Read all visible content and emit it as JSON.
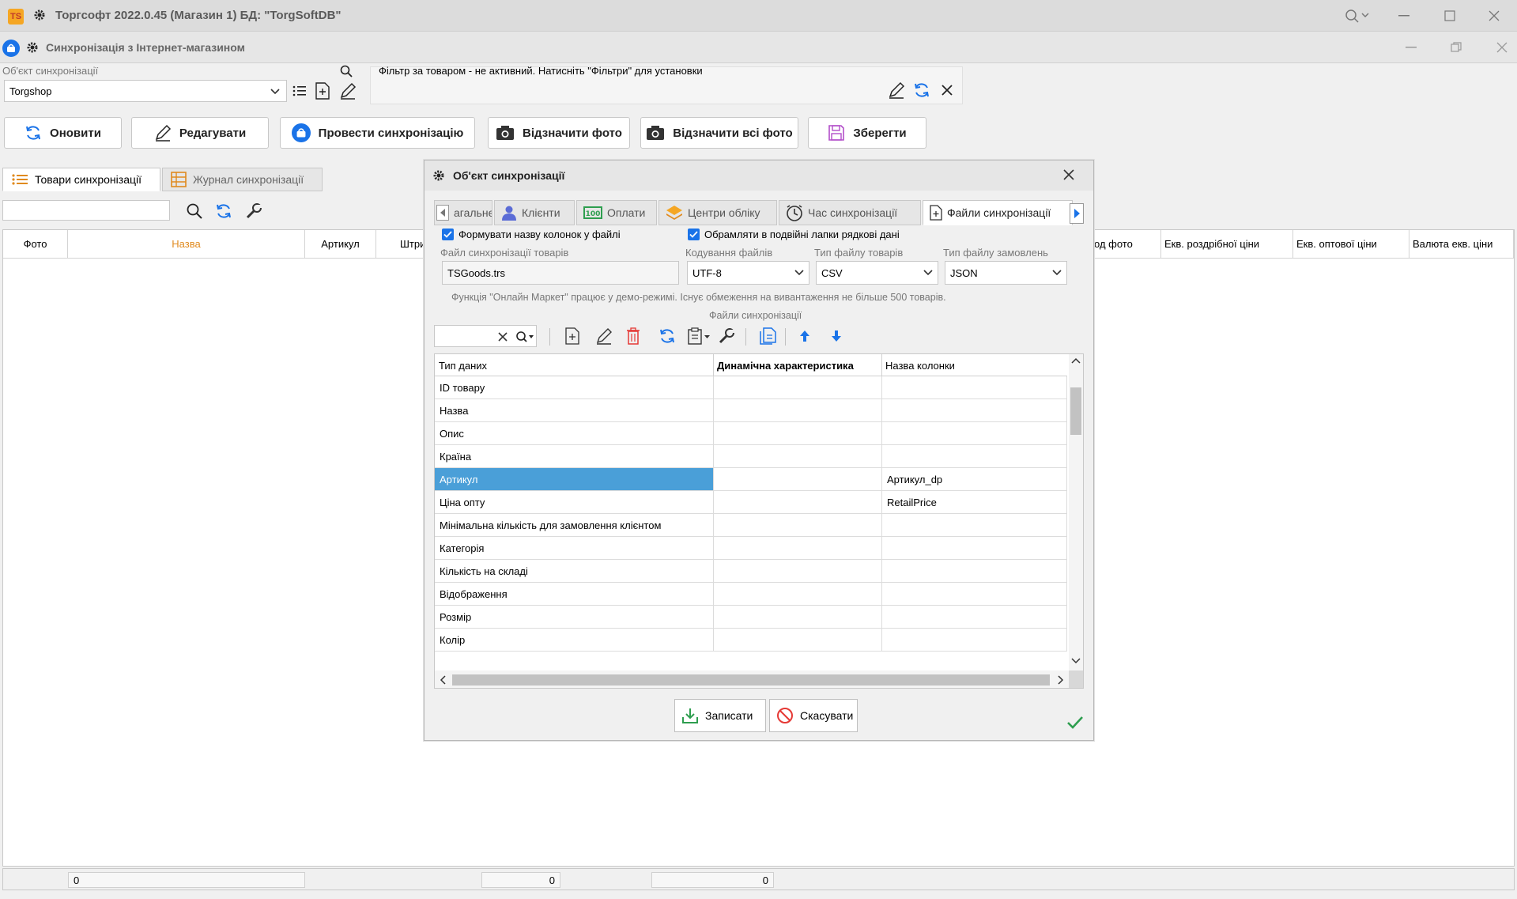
{
  "app": {
    "title": "Торгсофт 2022.0.45 (Магазин 1) БД: \"TorgSoftDB\"",
    "logo_text": "TS"
  },
  "window": {
    "title": "Синхронізація з Інтернет-магазином"
  },
  "object": {
    "label": "Об'єкт синхронізації",
    "value": "Torgshop"
  },
  "filter": {
    "text": "Фільтр за товаром - не активний. Натисніть \"Фільтри\" для установки"
  },
  "toolbar": {
    "refresh": "Оновити",
    "edit": "Редагувати",
    "sync": "Провести синхронізацію",
    "mark_photo": "Відзначити фото",
    "mark_all_photo": "Відзначити всі фото",
    "save": "Зберегти"
  },
  "tabs": [
    {
      "label": "Товари синхронізації"
    },
    {
      "label": "Журнал синхронізації"
    }
  ],
  "grid": {
    "columns": [
      "Фото",
      "Назва",
      "Артикул",
      "Штри",
      "од фото",
      "Екв. роздрібної ціни",
      "Екв. оптової ціни",
      "Валюта екв. ціни"
    ]
  },
  "status": {
    "f1": "0",
    "f2": "0",
    "f3": "0"
  },
  "dialog": {
    "title": "Об'єкт синхронізації",
    "tabs": [
      "агальне",
      "Клієнти",
      "Оплати",
      "Центри обліку",
      "Час синхронізації",
      "Файли синхронізації"
    ],
    "check1": "Формувати назву колонок у файлі",
    "check2": "Обрамляти в подвійні лапки рядкові дані",
    "file_label": "Файл синхронізації товарів",
    "file_value": "TSGoods.trs",
    "enc_label": "Кодування файлів",
    "enc_value": "UTF-8",
    "goods_type_label": "Тип файлу товарів",
    "goods_type_value": "CSV",
    "orders_type_label": "Тип файлу замовлень",
    "orders_type_value": "JSON",
    "demo_note": "Функція \"Онлайн Маркет\" працює у демо-режимі. Існує обмеження на вивантаження не більше 500 товарів.",
    "files_section": "Файли синхронізації",
    "table": {
      "headers": [
        "Тип даних",
        "Динамічна характеристика",
        "Назва колонки"
      ],
      "rows": [
        [
          "ID товару",
          "",
          ""
        ],
        [
          "Назва",
          "",
          ""
        ],
        [
          "Опис",
          "",
          ""
        ],
        [
          "Країна",
          "",
          ""
        ],
        [
          "Артикул",
          "",
          "Артикул_dp"
        ],
        [
          "Ціна опту",
          "",
          "RetailPrice"
        ],
        [
          "Мінімальна кількість для замовлення клієнтом",
          "",
          ""
        ],
        [
          "Категорія",
          "",
          ""
        ],
        [
          "Кількість на складі",
          "",
          ""
        ],
        [
          "Відображення",
          "",
          ""
        ],
        [
          "Розмір",
          "",
          ""
        ],
        [
          "Колір",
          "",
          ""
        ]
      ]
    },
    "write": "Записати",
    "cancel": "Скасувати"
  },
  "colors": {
    "accent": "#1a73e8",
    "selection": "#4a9fd8",
    "header_orange": "#e08a1e",
    "delete_red": "#e53935",
    "ok_green": "#2e9e4f"
  }
}
